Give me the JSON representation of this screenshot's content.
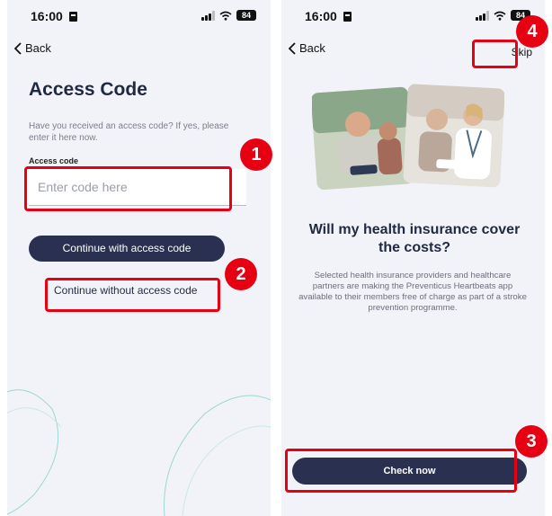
{
  "left_screen": {
    "status": {
      "time": "16:00",
      "battery": "84"
    },
    "back_label": "Back",
    "title": "Access Code",
    "description": "Have you received an access code? If yes, please enter it here now.",
    "field_label": "Access code",
    "input_placeholder": "Enter code here",
    "input_value": "",
    "primary_button": "Continue with access code",
    "secondary_link": "Continue without access code"
  },
  "right_screen": {
    "status": {
      "time": "16:00",
      "battery": "84"
    },
    "back_label": "Back",
    "skip_label": "Skip",
    "hero_image": "photo-collage-elderly-people-with-nurse",
    "headline": "Will my health insurance cover the costs?",
    "body": "Selected health insurance providers and healthcare partners are making the Preventicus Heartbeats app available to their members free of charge as part of a stroke prevention programme.",
    "check_button": "Check now"
  },
  "callouts": [
    "1",
    "2",
    "3",
    "4"
  ],
  "colors": {
    "primary": "#2a3150",
    "highlight": "#e60012",
    "background": "#f2f3f8",
    "text_muted": "#7a7e8a"
  },
  "icons": [
    "chevron-left-icon",
    "sim-icon",
    "signal-icon",
    "wifi-icon",
    "battery-icon"
  ]
}
